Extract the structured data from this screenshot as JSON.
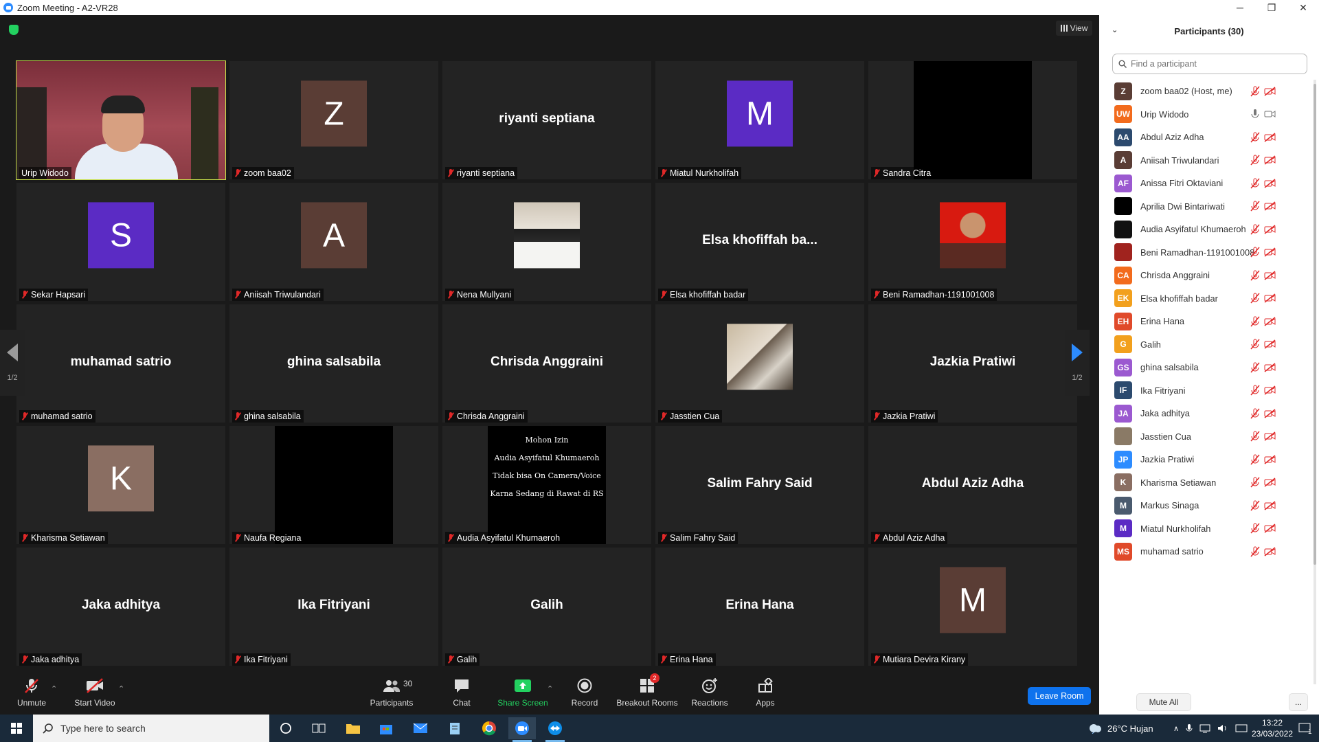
{
  "window": {
    "title": "Zoom Meeting - A2-VR28",
    "minimize": "─",
    "maximize": "❐",
    "close": "✕"
  },
  "view_button": "View",
  "tiles": [
    {
      "name": "Urip Widodo",
      "type": "video",
      "muted": false
    },
    {
      "name": "zoom baa02",
      "type": "avatar",
      "letter": "Z",
      "color": "#5a3d35"
    },
    {
      "name": "riyanti septiana",
      "type": "bigname",
      "big": "riyanti septiana"
    },
    {
      "name": "Miatul Nurkholifah",
      "type": "avatar",
      "letter": "M",
      "color": "#5b2bc4"
    },
    {
      "name": "Sandra Citra",
      "type": "black"
    },
    {
      "name": "Sekar Hapsari",
      "type": "avatar",
      "letter": "S",
      "color": "#5b2bc4"
    },
    {
      "name": "Aniisah Triwulandari",
      "type": "avatar",
      "letter": "A",
      "color": "#5a3d35"
    },
    {
      "name": "Nena Mullyani",
      "type": "photo",
      "photo": "nena"
    },
    {
      "name": "Elsa khofiffah badar",
      "type": "bigname",
      "big": "Elsa  khofiffah  ba..."
    },
    {
      "name": "Beni Ramadhan-1191001008",
      "type": "photo",
      "photo": "beni"
    },
    {
      "name": "muhamad satrio",
      "type": "bigname",
      "big": "muhamad satrio"
    },
    {
      "name": "ghina salsabila",
      "type": "bigname",
      "big": "ghina salsabila"
    },
    {
      "name": "Chrisda Anggraini",
      "type": "bigname",
      "big": "Chrisda Anggraini"
    },
    {
      "name": "Jasstien Cua",
      "type": "photo",
      "photo": "jasstien"
    },
    {
      "name": "Jazkia Pratiwi",
      "type": "bigname",
      "big": "Jazkia Pratiwi"
    },
    {
      "name": "Kharisma Setiawan",
      "type": "avatar",
      "letter": "K",
      "color": "#8a6e62"
    },
    {
      "name": "Naufa Regiana",
      "type": "black"
    },
    {
      "name": "Audia Asyifatul Khumaeroh",
      "type": "message",
      "lines": [
        "Mohon Izin",
        "Audia Asyifatul Khumaeroh",
        "Tidak bisa On Camera/Voice",
        "Karna Sedang di Rawat di RS"
      ]
    },
    {
      "name": "Salim Fahry Said",
      "type": "bigname",
      "big": "Salim Fahry Said"
    },
    {
      "name": "Abdul Aziz Adha",
      "type": "bigname",
      "big": "Abdul Aziz Adha"
    },
    {
      "name": "Jaka adhitya",
      "type": "bigname",
      "big": "Jaka adhitya"
    },
    {
      "name": "Ika Fitriyani",
      "type": "bigname",
      "big": "Ika Fitriyani"
    },
    {
      "name": "Galih",
      "type": "bigname",
      "big": "Galih"
    },
    {
      "name": "Erina Hana",
      "type": "bigname",
      "big": "Erina Hana"
    },
    {
      "name": "Mutiara Devira Kirany",
      "type": "avatar",
      "letter": "M",
      "color": "#5a3d35"
    }
  ],
  "pager": {
    "prev_label": "1/2",
    "next_label": "1/2"
  },
  "toolbar": {
    "unmute": "Unmute",
    "start_video": "Start Video",
    "participants": "Participants",
    "participants_count": "30",
    "chat": "Chat",
    "share_screen": "Share Screen",
    "record": "Record",
    "breakout_rooms": "Breakout Rooms",
    "breakout_badge": "2",
    "reactions": "Reactions",
    "apps": "Apps",
    "leave": "Leave Room"
  },
  "panel": {
    "title": "Participants (30)",
    "search_placeholder": "Find a participant",
    "mute_all": "Mute All",
    "more": "...",
    "participants": [
      {
        "name": "zoom baa02 (Host, me)",
        "initials": "Z",
        "color": "#5a3d35"
      },
      {
        "name": "Urip Widodo",
        "initials": "UW",
        "color": "#f26b1d",
        "unmuted": true
      },
      {
        "name": "Abdul Aziz Adha",
        "initials": "AA",
        "color": "#2c4a6e"
      },
      {
        "name": "Aniisah Triwulandari",
        "initials": "A",
        "color": "#5a3d35"
      },
      {
        "name": "Anissa Fitri Oktaviani",
        "initials": "AF",
        "color": "#9b59d0"
      },
      {
        "name": "Aprilia Dwi Bintariwati",
        "initials": "",
        "color": "#000000"
      },
      {
        "name": "Audia Asyifatul Khumaeroh",
        "initials": "",
        "color": "#111111"
      },
      {
        "name": "Beni Ramadhan-1191001008",
        "initials": "",
        "color": "#a0231e"
      },
      {
        "name": "Chrisda Anggraini",
        "initials": "CA",
        "color": "#f26b1d"
      },
      {
        "name": "Elsa khofiffah badar",
        "initials": "EK",
        "color": "#f2a01d"
      },
      {
        "name": "Erina Hana",
        "initials": "EH",
        "color": "#e04a2a"
      },
      {
        "name": "Galih",
        "initials": "G",
        "color": "#f2a01d"
      },
      {
        "name": "ghina salsabila",
        "initials": "GS",
        "color": "#9b59d0"
      },
      {
        "name": "Ika Fitriyani",
        "initials": "IF",
        "color": "#2c4a6e"
      },
      {
        "name": "Jaka adhitya",
        "initials": "JA",
        "color": "#9b59d0"
      },
      {
        "name": "Jasstien Cua",
        "initials": "",
        "color": "#8a7a66"
      },
      {
        "name": "Jazkia Pratiwi",
        "initials": "JP",
        "color": "#2d8cff"
      },
      {
        "name": "Kharisma Setiawan",
        "initials": "K",
        "color": "#8a6e62"
      },
      {
        "name": "Markus Sinaga",
        "initials": "M",
        "color": "#4a5a6e"
      },
      {
        "name": "Miatul Nurkholifah",
        "initials": "M",
        "color": "#5b2bc4"
      },
      {
        "name": "muhamad satrio",
        "initials": "MS",
        "color": "#e04a2a"
      }
    ]
  },
  "taskbar": {
    "search_placeholder": "Type here to search",
    "weather": "26°C  Hujan",
    "time": "13:22",
    "date": "23/03/2022",
    "notif": "1"
  }
}
